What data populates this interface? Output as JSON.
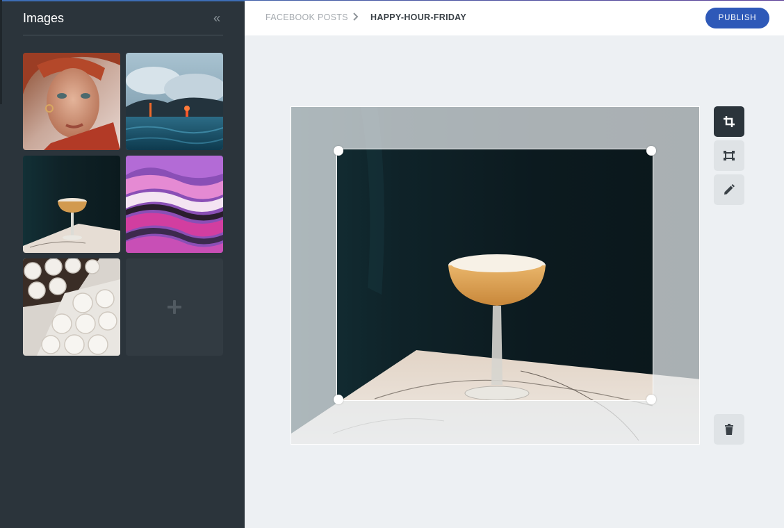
{
  "sidebar": {
    "title": "Images",
    "collapse_glyph": "«",
    "collapse_icon": "double-chevron-left-icon",
    "thumbnails": [
      {
        "name": "thumb-woman-portrait"
      },
      {
        "name": "thumb-lava-ocean"
      },
      {
        "name": "thumb-cocktail"
      },
      {
        "name": "thumb-pink-purple-abstract"
      },
      {
        "name": "thumb-meringues"
      }
    ],
    "add_icon": "plus-icon"
  },
  "header": {
    "breadcrumb_root": "FACEBOOK POSTS",
    "breadcrumb_separator_icon": "chevron-right-icon",
    "breadcrumb_current": "HAPPY-HOUR-FRIDAY",
    "publish_label": "PUBLISH"
  },
  "tools": {
    "crop_icon": "crop-icon",
    "resize_icon": "resize-icon",
    "edit_icon": "pencil-icon",
    "delete_icon": "trash-icon"
  },
  "colors": {
    "sidebar_bg": "#2b343b",
    "accent": "#2e59b8",
    "canvas_bg": "#edf0f3",
    "active_tool": "#2b343b"
  }
}
